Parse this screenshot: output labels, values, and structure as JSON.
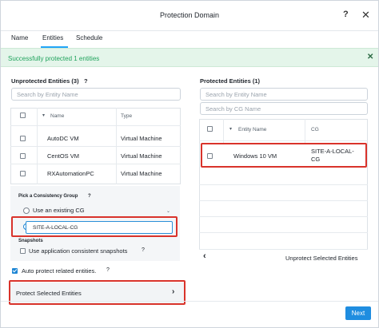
{
  "window": {
    "title": "Protection Domain"
  },
  "tabs": [
    {
      "label": "Name"
    },
    {
      "label": "Entities"
    },
    {
      "label": "Schedule"
    }
  ],
  "banner": {
    "text": "Successfully protected 1 entities"
  },
  "left": {
    "title": "Unprotected Entities (3)",
    "help": "?",
    "search_placeholder": "Search by Entity Name",
    "columns": {
      "name": "Name",
      "type": "Type"
    },
    "rows": [
      {
        "name": "AutoDC VM",
        "type": "Virtual Machine"
      },
      {
        "name": "CentOS VM",
        "type": "Virtual Machine"
      },
      {
        "name": "RXAutomationPC",
        "type": "Virtual Machine"
      }
    ],
    "cg": {
      "title": "Pick a Consistency Group",
      "help": "?",
      "existing_label": "Use an existing CG",
      "new_value": "SITE-A-LOCAL-CG",
      "snapshots_title": "Snapshots",
      "snapshots_label": "Use application consistent snapshots",
      "snapshots_help": "?"
    },
    "auto_protect_label": "Auto protect related entities.",
    "auto_protect_help": "?",
    "protect_button": "Protect Selected Entities"
  },
  "right": {
    "title": "Protected Entities (1)",
    "search_entity_placeholder": "Search by Entity Name",
    "search_cg_placeholder": "Search by CG Name",
    "columns": {
      "name": "Entity Name",
      "cg": "CG"
    },
    "rows": [
      {
        "name": "Windows 10 VM",
        "cg": "SITE-A-LOCAL-CG"
      }
    ],
    "unprotect_button": "Unprotect Selected Entities"
  },
  "footer": {
    "next_label": "Next"
  },
  "colors": {
    "accent": "#1f8de0",
    "success": "#21a35d",
    "highlight": "#d9332b"
  }
}
